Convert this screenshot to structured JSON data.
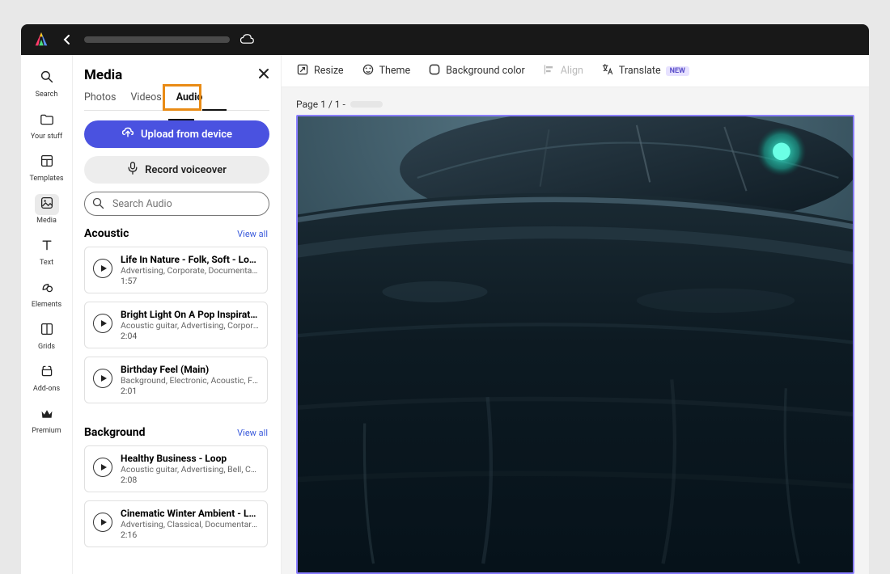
{
  "rail": {
    "items": [
      {
        "name": "search",
        "label": "Search"
      },
      {
        "name": "your-stuff",
        "label": "Your stuff"
      },
      {
        "name": "templates",
        "label": "Templates"
      },
      {
        "name": "media",
        "label": "Media"
      },
      {
        "name": "text",
        "label": "Text"
      },
      {
        "name": "elements",
        "label": "Elements"
      },
      {
        "name": "grids",
        "label": "Grids"
      },
      {
        "name": "addons",
        "label": "Add-ons"
      },
      {
        "name": "premium",
        "label": "Premium"
      }
    ]
  },
  "panel": {
    "title": "Media",
    "tabs": {
      "photos": "Photos",
      "videos": "Videos",
      "audio": "Audio"
    },
    "upload_label": "Upload from device",
    "record_label": "Record voiceover",
    "search_placeholder": "Search Audio",
    "view_all": "View all",
    "sections": [
      {
        "title": "Acoustic",
        "tracks": [
          {
            "title": "Life In Nature - Folk, Soft - Loop",
            "tags": "Advertising, Corporate, Documentary, D…",
            "duration": "1:57"
          },
          {
            "title": "Bright Light On A Pop Inspiratio…",
            "tags": "Acoustic guitar, Advertising, Corporate, …",
            "duration": "2:04"
          },
          {
            "title": "Birthday Feel (Main)",
            "tags": "Background, Electronic, Acoustic, Folk, …",
            "duration": "2:01"
          }
        ]
      },
      {
        "title": "Background",
        "tracks": [
          {
            "title": "Healthy Business - Loop",
            "tags": "Acoustic guitar, Advertising, Bell, Corpor…",
            "duration": "2:08"
          },
          {
            "title": "Cinematic Winter Ambient - Loop",
            "tags": "Advertising, Classical, Documentary, Dr…",
            "duration": "2:16"
          }
        ]
      }
    ]
  },
  "toolbar": {
    "resize": "Resize",
    "theme": "Theme",
    "background": "Background color",
    "align": "Align",
    "translate": "Translate",
    "new_badge": "NEW"
  },
  "canvas": {
    "page_label": "Page 1 / 1 -"
  }
}
